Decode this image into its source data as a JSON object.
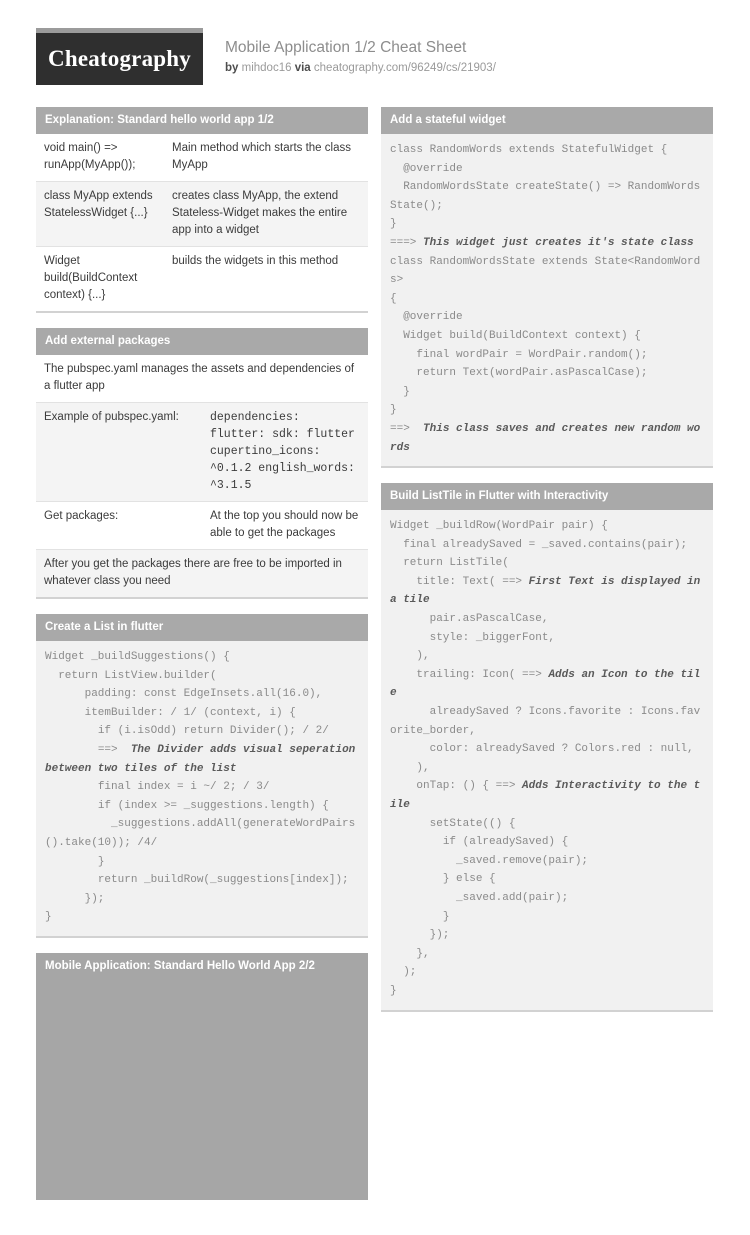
{
  "header": {
    "logo_text": "Cheatography",
    "title": "Mobile Application 1/2 Cheat Sheet",
    "by_label": "by",
    "author": "mihdoc16",
    "via_label": "via",
    "url": "cheatography.com/96249/cs/21903/"
  },
  "left_column": {
    "cards": [
      {
        "title": "Explanation: Standard hello world app 1/2",
        "type": "kv",
        "rows": [
          {
            "key": "void main() => runApp(MyApp());",
            "value": "Main method which starts the class MyApp"
          },
          {
            "key": "class MyApp extends StatelessWidget {...}",
            "value": "creates class MyApp, the extend Stateless-Widget makes the entire app into a widget"
          },
          {
            "key": "Widget build(BuildContext context) {...}",
            "value": "builds the widgets in this method"
          }
        ]
      },
      {
        "title": "Add external packages",
        "type": "kv",
        "rows": [
          {
            "full": "The pubspec.yaml manages the assets and dependencies of a flutter app"
          },
          {
            "key": "Example of pubspec.yaml:",
            "value": "dependencies: flutter: sdk: flutter cupertino_icons: ^0.1.2 english_words: ^3.1.5",
            "mono": true
          },
          {
            "key": "Get packages:",
            "value": "At the top you should now be able to get the packages"
          },
          {
            "full": "After you get the packages there are free to be imported in whatever class you need"
          }
        ]
      },
      {
        "title": "Create a List in flutter",
        "type": "code",
        "code": "Widget _buildSuggestions() {\n  return ListView.builder(\n      padding: const EdgeInsets.all(16.0),\n      itemBuilder: / 1/ (context, i) {\n        if (i.isOdd) return Divider(); / 2/\n        ==>  @@The Divider adds visual seperation between two tiles of the list@@\n        final index = i ~/ 2; / 3/\n        if (index >= _suggestions.length) {\n          _suggestions.addAll(generateWordPairs().take(10)); /4/\n        }\n        return _buildRow(_suggestions[index]);\n      });\n}"
      },
      {
        "title": "Mobile Application: Standard Hello World App 2/2",
        "type": "image"
      }
    ]
  },
  "right_column": {
    "cards": [
      {
        "title": "Add a stateful widget",
        "type": "code",
        "code": "class RandomWords extends StatefulWidget {\n  @override\n  RandomWordsState createState() => RandomWordsState();\n}\n===> @@This widget just creates it's state class@@\nclass RandomWordsState extends State<RandomWords>\n{\n  @override\n  Widget build(BuildContext context) {\n    final wordPair = WordPair.random();\n    return Text(wordPair.asPascalCase);\n  }\n}\n==>  @@This class saves and creates new random words@@"
      },
      {
        "title": "Build ListTile in Flutter with Interactivity",
        "type": "code",
        "code": "Widget _buildRow(WordPair pair) {\n  final alreadySaved = _saved.contains(pair);\n  return ListTile(\n    title: Text( ==> @@First Text is displayed in a tile@@\n      pair.asPascalCase,\n      style: _biggerFont,\n    ),\n    trailing: Icon( ==> @@Adds an Icon to the tile@@\n      alreadySaved ? Icons.favorite : Icons.favorite_border,\n      color: alreadySaved ? Colors.red : null,\n    ),\n    onTap: () { ==> @@Adds Interactivity to the tile@@\n      setState(() {\n        if (alreadySaved) {\n          _saved.remove(pair);\n        } else {\n          _saved.add(pair);\n        }\n      });\n    },\n  );\n}"
      }
    ]
  },
  "colors": {
    "card_header_bg": "#a9a9a9",
    "code_bg": "#f1f1f1",
    "logo_bg": "#2f2f2f",
    "image_placeholder": "#a6a6a6"
  }
}
